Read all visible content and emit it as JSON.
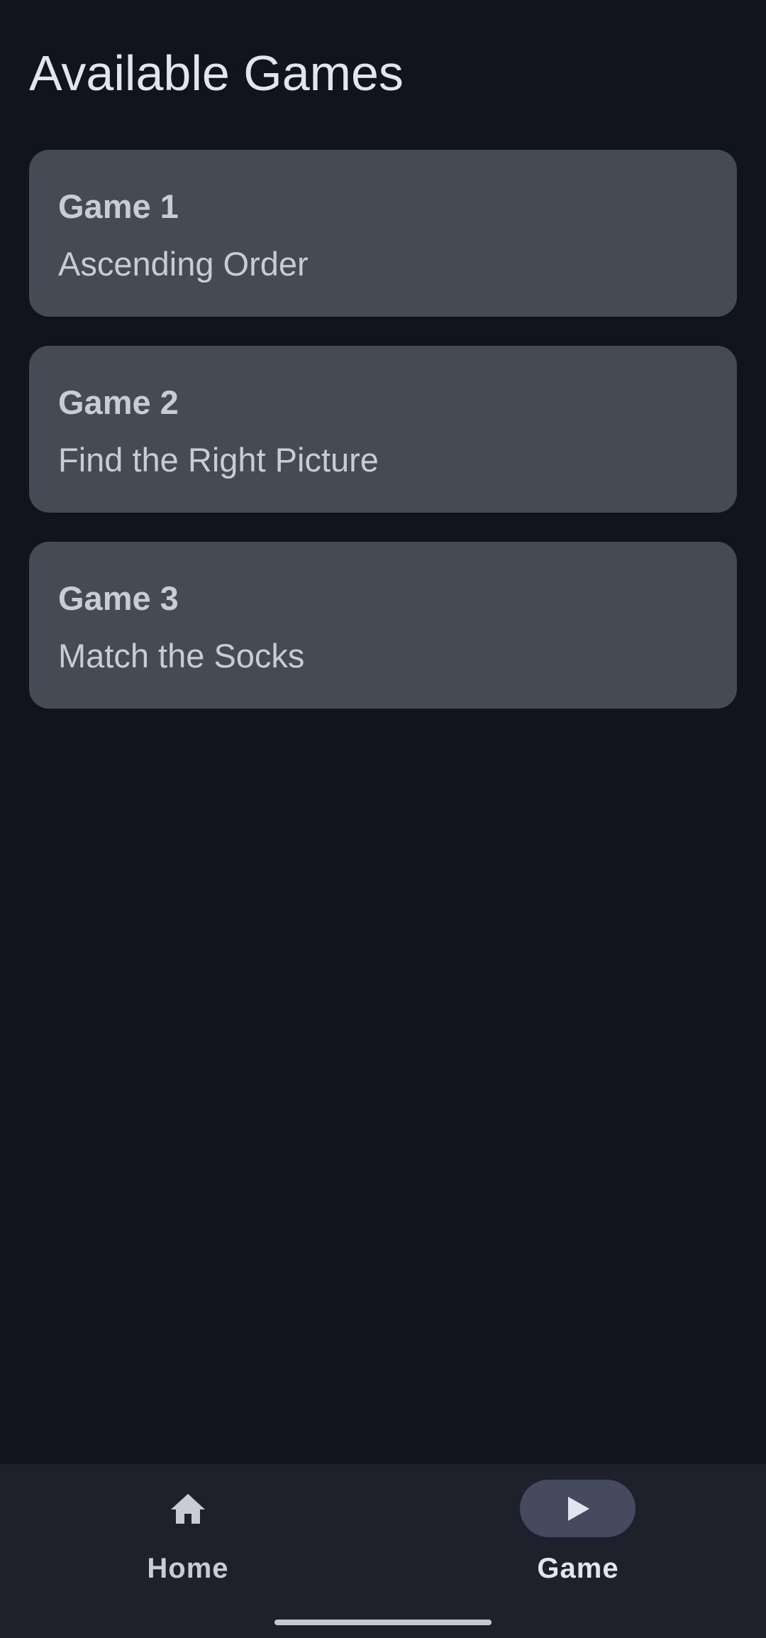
{
  "page": {
    "title": "Available Games"
  },
  "games": [
    {
      "title": "Game 1",
      "subtitle": "Ascending Order"
    },
    {
      "title": "Game 2",
      "subtitle": "Find the Right Picture"
    },
    {
      "title": "Game 3",
      "subtitle": "Match the Socks"
    }
  ],
  "bottom_nav": {
    "items": [
      {
        "label": "Home",
        "icon": "home-icon",
        "selected": false
      },
      {
        "label": "Game",
        "icon": "play-icon",
        "selected": true
      }
    ]
  },
  "colors": {
    "background": "#11141c",
    "card": "#464a54",
    "nav_background": "#1e212c",
    "nav_indicator": "#454a5e",
    "text": "#c9ccd6"
  }
}
